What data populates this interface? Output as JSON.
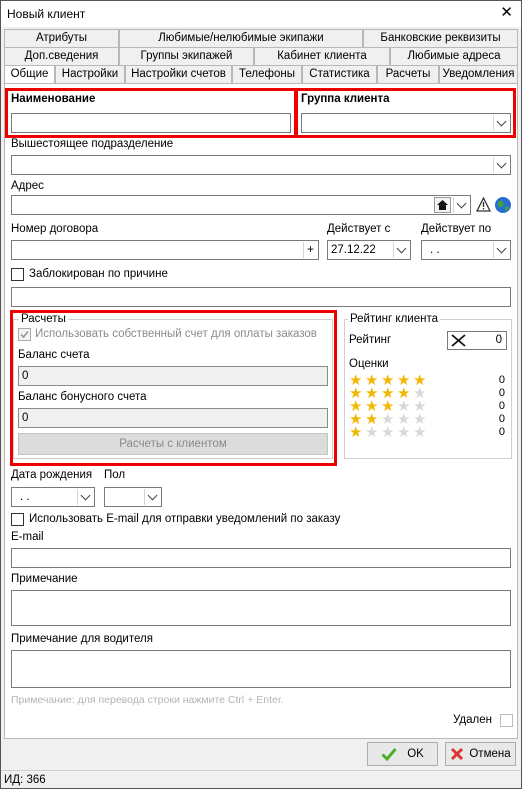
{
  "window": {
    "title": "Новый клиент",
    "close_glyph": "✕"
  },
  "tabs": {
    "row1": [
      "Атрибуты",
      "Любимые/нелюбимые экипажи",
      "Банковские реквизиты"
    ],
    "row2": [
      "Доп.сведения",
      "Группы экипажей",
      "Кабинет клиента",
      "Любимые адреса"
    ],
    "row3": [
      "Общие",
      "Настройки",
      "Настройки счетов",
      "Телефоны",
      "Статистика",
      "Расчеты",
      "Уведомления"
    ]
  },
  "form": {
    "name_label": "Наименование",
    "name_value": "",
    "group_label": "Группа клиента",
    "group_value": "",
    "parent_label": "Вышестоящее подразделение",
    "parent_value": "",
    "address_label": "Адрес",
    "address_value": "",
    "contract_label": "Номер договора",
    "contract_value": "",
    "valid_from_label": "Действует с",
    "valid_from_value": "27.12.22",
    "valid_to_label": "Действует по",
    "valid_to_value": ". .",
    "blocked_label": "Заблокирован по причине",
    "blocked_reason": "",
    "birth_label": "Дата рождения",
    "birth_value": ". .",
    "gender_label": "Пол",
    "gender_value": "",
    "use_email_label": "Использовать E-mail для отправки уведомлений по заказу",
    "email_label": "E-mail",
    "email_value": "",
    "note_label": "Примечание",
    "driver_note_label": "Примечание для водителя",
    "hint": "Примечание: для перевода строки нажмите Ctrl + Enter.",
    "deleted_label": "Удален"
  },
  "payments": {
    "title": "Расчеты",
    "own_account_label": "Использовать собственный счет для оплаты заказов",
    "balance_label": "Баланс счета",
    "balance_value": "0",
    "bonus_label": "Баланс бонусного счета",
    "bonus_value": "0",
    "button_label": "Расчеты с клиентом"
  },
  "rating": {
    "title": "Рейтинг клиента",
    "rating_label": "Рейтинг",
    "rating_value": "0",
    "scores_label": "Оценки",
    "rows": [
      {
        "stars": 5,
        "count": "0"
      },
      {
        "stars": 4,
        "count": "0"
      },
      {
        "stars": 3,
        "count": "0"
      },
      {
        "stars": 2,
        "count": "0"
      },
      {
        "stars": 1,
        "count": "0"
      }
    ]
  },
  "buttons": {
    "ok": "OK",
    "cancel": "Отмена"
  },
  "status": {
    "id_text": "ИД: 366"
  },
  "colors": {
    "highlight": "#e00000",
    "ok_check": "#4caf2a",
    "cancel_x": "#d33"
  }
}
